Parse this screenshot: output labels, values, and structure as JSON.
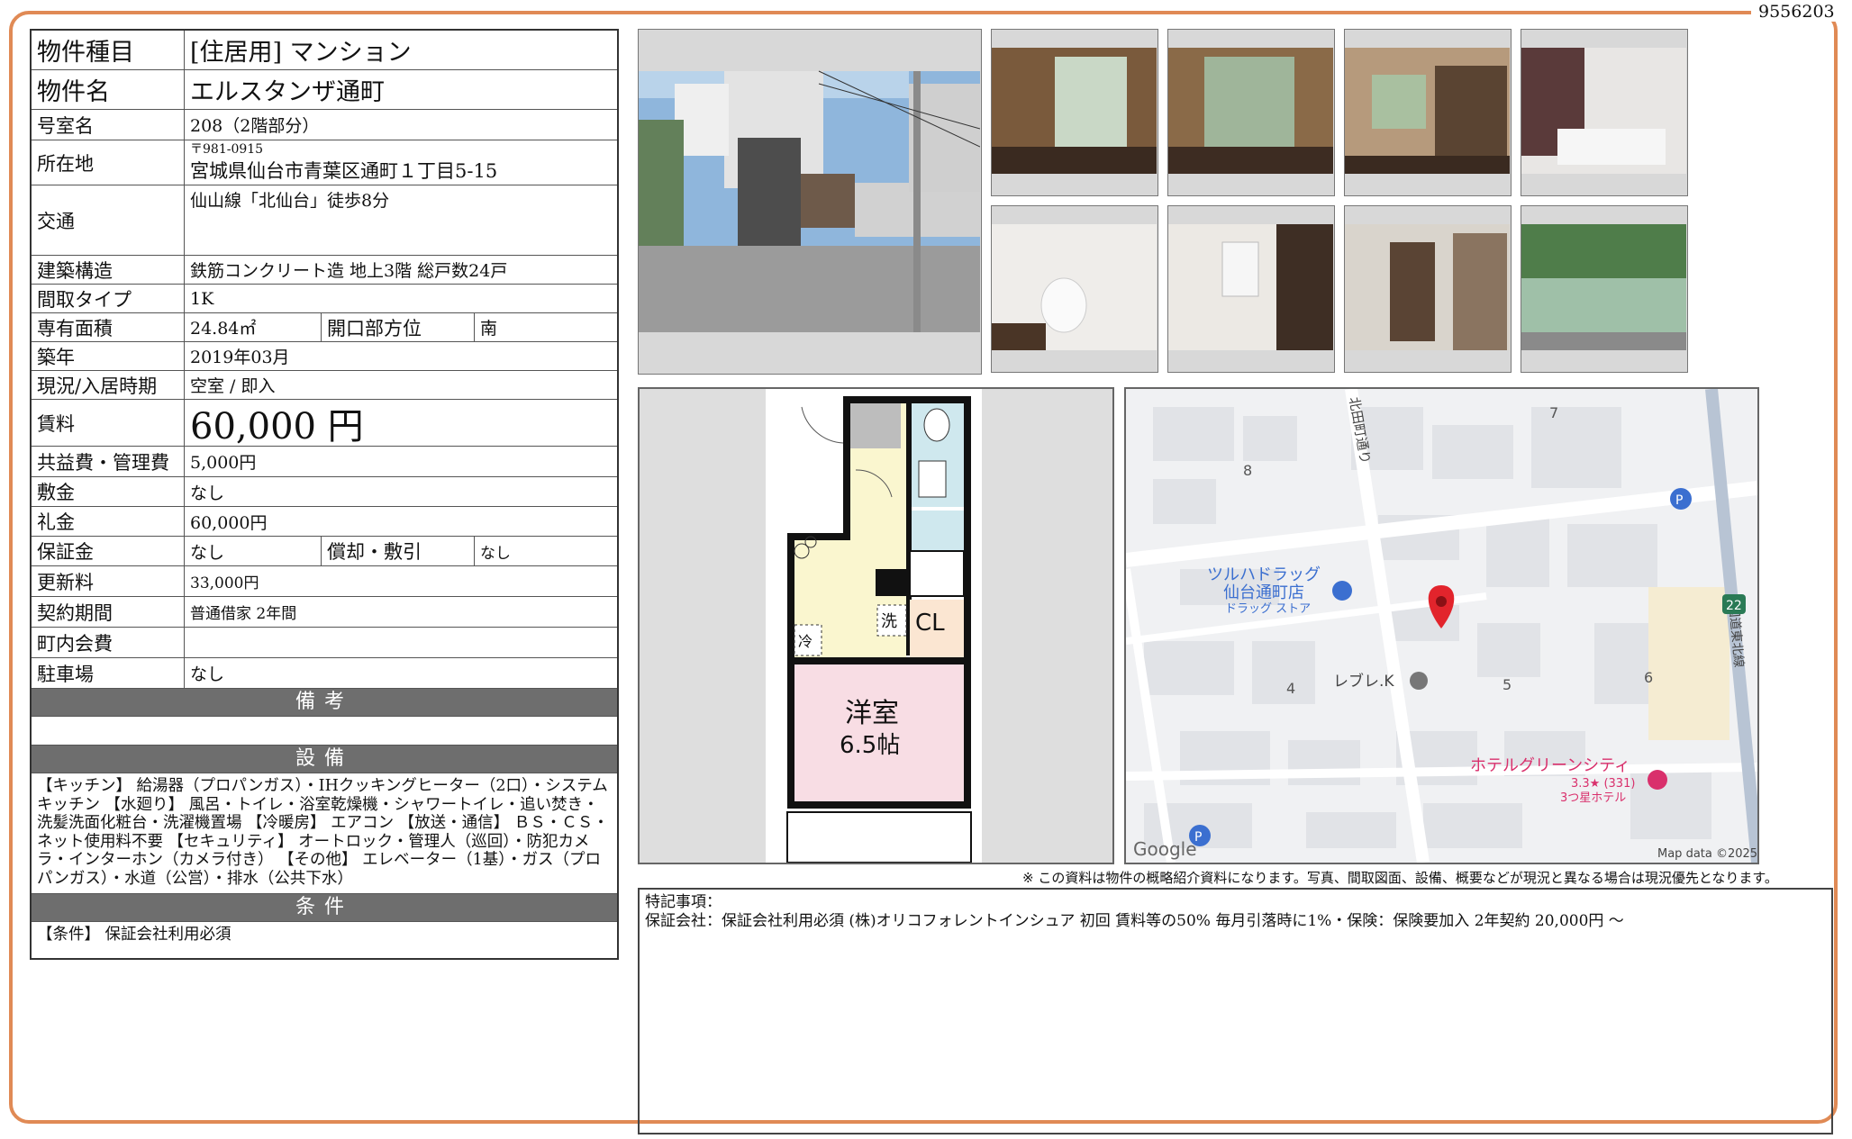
{
  "ref_number": "9556203",
  "property": {
    "type_label": "物件種目",
    "type_value": "[住居用]  マンション",
    "name_label": "物件名",
    "name_value": "エルスタンザ通町",
    "room_label": "号室名",
    "room_value": "208（2階部分）",
    "address_label": "所在地",
    "postal": "〒981-0915",
    "address_value": "宮城県仙台市青葉区通町１丁目5-15",
    "transport_label": "交通",
    "transport_value": "仙山線「北仙台」徒歩8分",
    "structure_label": "建築構造",
    "structure_value": "鉄筋コンクリート造  地上3階  総戸数24戸",
    "layout_label": "間取タイプ",
    "layout_value": "1K",
    "area_label": "専有面積",
    "area_value": "24.84㎡",
    "orientation_label": "開口部方位",
    "orientation_value": "南",
    "built_label": "築年",
    "built_value": "2019年03月",
    "status_label": "現況/入居時期",
    "status_value": "空室 /  即入",
    "rent_label": "賃料",
    "rent_value": "60,000 円",
    "fee_label": "共益費・管理費",
    "fee_value": "5,000円",
    "deposit_label": "敷金",
    "deposit_value": "なし",
    "key_money_label": "礼金",
    "key_money_value": "60,000円",
    "guarantee_label": "保証金",
    "guarantee_value": "なし",
    "amort_label": "償却・敷引",
    "amort_value": "なし",
    "renewal_label": "更新料",
    "renewal_value": "33,000円",
    "contract_label": "契約期間",
    "contract_value": "普通借家  2年間",
    "community_label": "町内会費",
    "community_value": "",
    "parking_label": "駐車場",
    "parking_value": "なし"
  },
  "sections": {
    "remarks_title": "備考",
    "remarks_text": "",
    "equipment_title": "設備",
    "equipment_text": "【キッチン】 給湯器（プロパンガス）・IHクッキングヒーター（2口）・システムキッチン 【水廻り】 風呂・トイレ・浴室乾燥機・シャワートイレ・追い焚き・洗髪洗面化粧台・洗濯機置場 【冷暖房】 エアコン 【放送・通信】 ＢＳ・ＣＳ・ネット使用料不要 【セキュリティ】 オートロック・管理人（巡回）・防犯カメラ・インターホン（カメラ付き） 【その他】 エレベーター（1基）・ガス（プロパンガス）・水道（公営）・排水（公共下水）",
    "conditions_title": "条件",
    "conditions_text": "【条件】 保証会社利用必須"
  },
  "floorplan": {
    "room_name": "洋室",
    "room_size": "6.5帖",
    "cl": "CL",
    "wash": "洗",
    "fridge": "冷"
  },
  "map": {
    "street_vertical": "北田町通り",
    "street_right": "国道東北線",
    "store_name": "ツルハドラッグ",
    "store_branch": "仙台通町店",
    "store_type": "ドラッグ ストア",
    "place2": "レブレ.K",
    "hotel_name": "ホテルグリーンシティ",
    "hotel_rating": "3.3★ (331)",
    "hotel_class": "3つ星ホテル",
    "block_4": "4",
    "block_5": "5",
    "block_6": "6",
    "block_7": "7",
    "block_8": "8",
    "route": "22",
    "parking_p": "P",
    "google": "Google",
    "map_data": "Map data ©2025"
  },
  "disclaimer": "※ この資料は物件の概略紹介資料になります。写真、間取図面、設備、概要などが現況と異なる場合は現況優先となります。",
  "special_notes": {
    "title": "特記事項：",
    "text": "保証会社：保証会社利用必須 (株)オリコフォレントインシュア 初回  賃料等の50%  毎月引落時に1%・保険：保険要加入 2年契約 20,000円 〜"
  }
}
